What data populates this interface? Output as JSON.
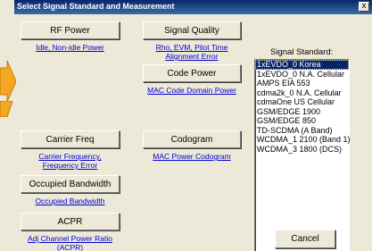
{
  "dialog": {
    "title": "Select Signal Standard and Measurement",
    "close_glyph": "x"
  },
  "buttons": {
    "rf_power": "RF Power",
    "signal_quality": "Signal Quality",
    "code_power": "Code Power",
    "carrier_freq": "Carrier Freq",
    "codogram": "Codogram",
    "occupied_bandwidth": "Occupied Bandwidth",
    "acpr": "ACPR",
    "cancel": "Cancel"
  },
  "links": {
    "rf_power": "Idle, Non-idle Power",
    "signal_quality": "Rho, EVM, Pilot Time\nAlignment Error",
    "code_power": "MAC Code Domain Power",
    "carrier_freq": "Carrier Frequency,\nFrequency Error",
    "codogram": "MAC Power Codogram",
    "occupied_bandwidth": "Occupied Bandwidth",
    "acpr": "Adj Channel Power Ratio\n(ACPR)"
  },
  "signal_standard": {
    "label": "Signal Standard:",
    "items": [
      "1xEVDO_0 Korea",
      "1xEVDO_0 N.A. Cellular",
      "AMPS EIA 553",
      "cdma2k_0 N.A. Cellular",
      "cdmaOne US Cellular",
      "GSM/EDGE 1900",
      "GSM/EDGE 850",
      "TD-SCDMA (A Band)",
      "WCDMA_1 2100 (Band 1)",
      "WCDMA_3 1800 (DCS)"
    ],
    "selected": "1xEVDO_0 Korea"
  },
  "colors": {
    "accent_arrow": "#f5a623",
    "selection": "#0a246a",
    "link": "#0000cc"
  }
}
